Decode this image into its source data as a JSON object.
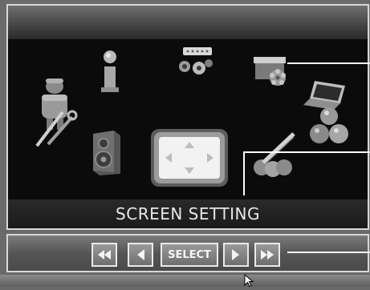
{
  "screen": {
    "title": "SCREEN SETTING"
  },
  "menu_icons": [
    {
      "name": "technician-tools-icon"
    },
    {
      "name": "information-icon"
    },
    {
      "name": "video-connectors-icon"
    },
    {
      "name": "projector-fan-icon"
    },
    {
      "name": "laptop-icon"
    },
    {
      "name": "speaker-icon"
    },
    {
      "name": "screen-setting-icon",
      "selected": true
    },
    {
      "name": "color-palette-icon"
    },
    {
      "name": "color-balls-icon"
    }
  ],
  "controls": {
    "rewind_glyph": "◀◀",
    "prev_glyph": "◀",
    "select_label": "SELECT",
    "next_glyph": "▶",
    "forward_glyph": "▶▶"
  },
  "colors": {
    "menu_background": "#0b0b0b",
    "frame_border": "#d8d8d8",
    "title_text": "#e8e8e8"
  }
}
